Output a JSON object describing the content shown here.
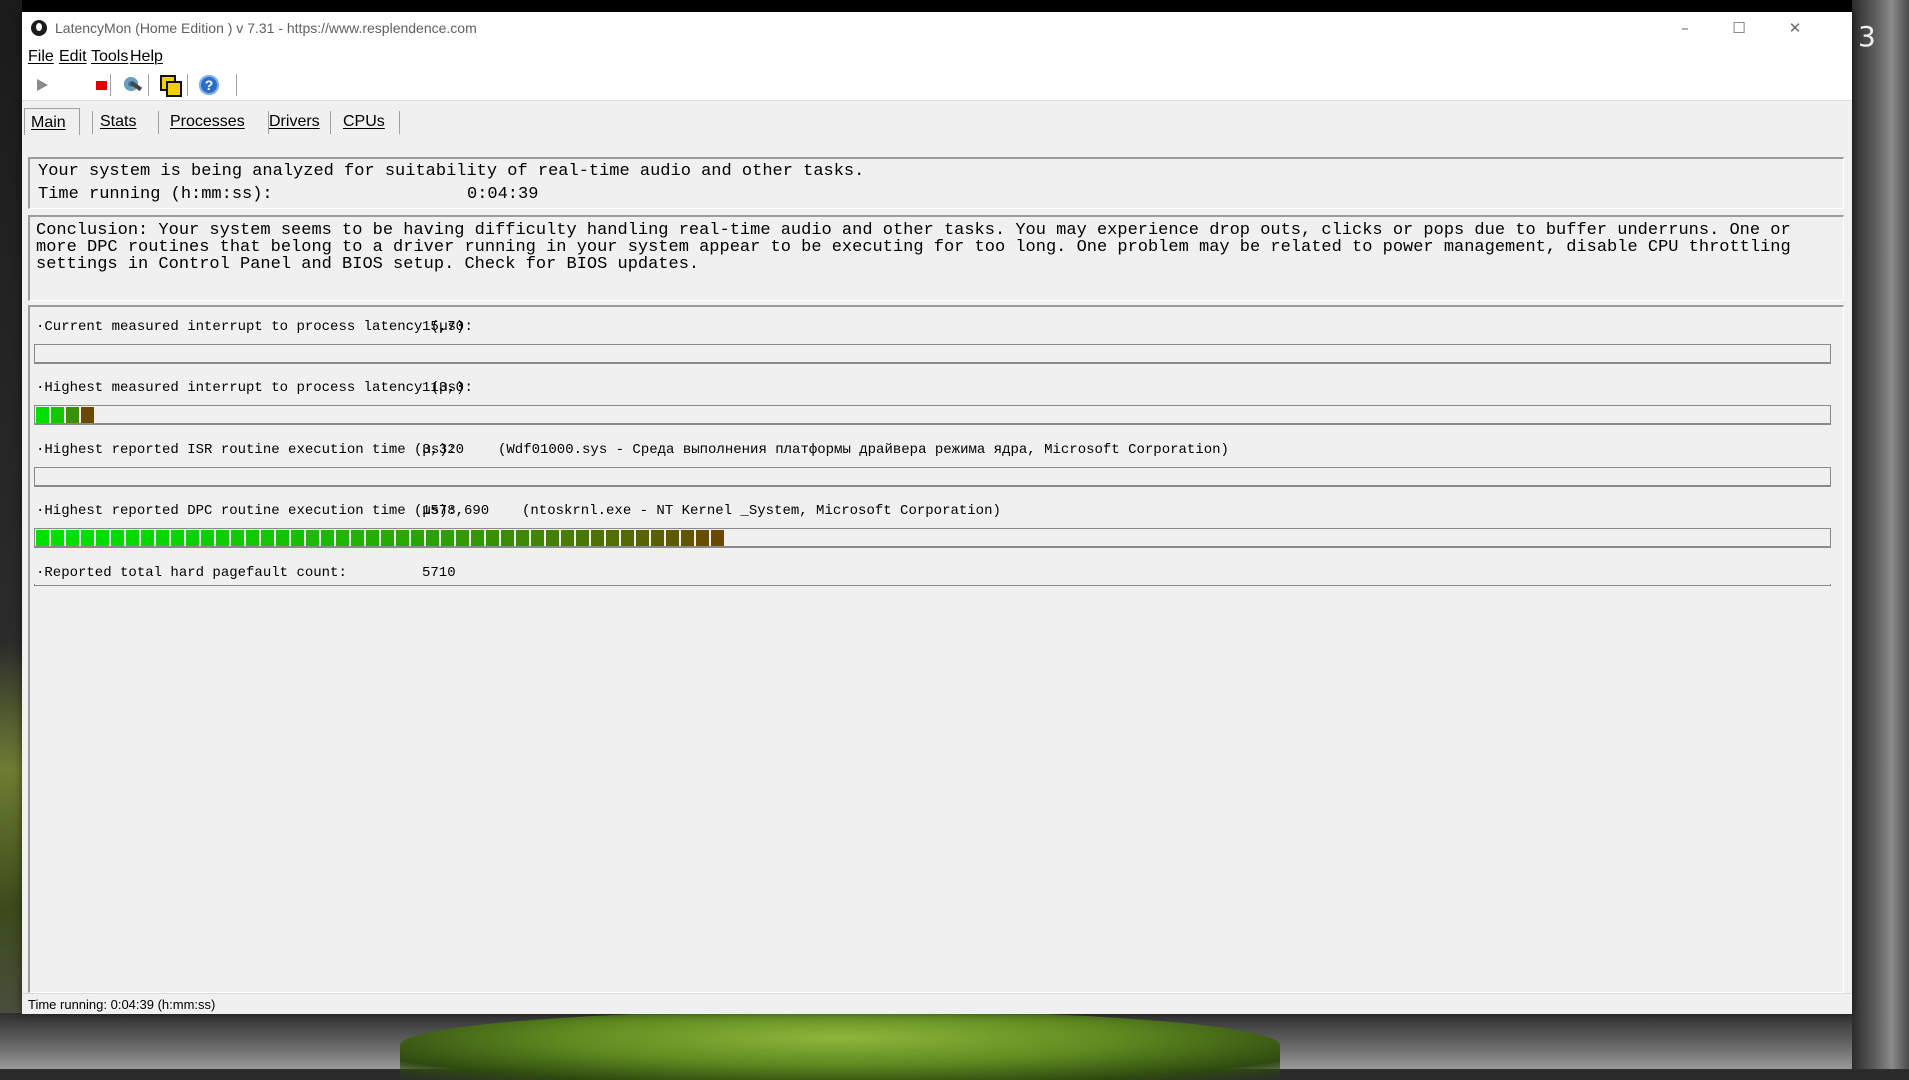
{
  "window": {
    "title": "LatencyMon  (Home Edition )  v 7.31 - https://www.resplendence.com",
    "controls": {
      "minimize": "–",
      "maximize": "☐",
      "close": "✕"
    }
  },
  "menu": {
    "file": "File",
    "edit": "Edit",
    "tools": "Tools",
    "help": "Help"
  },
  "toolbar": {
    "icons": [
      "play-icon",
      "stop-icon",
      "gear-icon",
      "windows-icon",
      "help-icon"
    ],
    "help_glyph": "?"
  },
  "tabs": [
    "Main",
    "Stats",
    "Processes",
    "Drivers",
    "CPUs"
  ],
  "status": {
    "line1": "Your system is being analyzed for suitability of real-time audio and other tasks.",
    "time_label": "Time running (h:mm:ss):",
    "time_value": "0:04:39"
  },
  "conclusion": "Conclusion: Your system seems to be having difficulty handling real-time audio and other tasks. You may experience drop outs, clicks or pops due to buffer underruns. One or more DPC routines that belong to a driver running in your system appear to be executing for too long. One problem may be related to power management, disable CPU throttling settings in Control Panel and BIOS setup. Check for BIOS updates.",
  "metrics": [
    {
      "label": "·Current measured interrupt to process latency (µs):",
      "value": "15,70",
      "detail": "",
      "bar_level": 0,
      "bar_max_segments": 0
    },
    {
      "label": "·Highest measured interrupt to process latency (µs):",
      "value": "113,0",
      "detail": "",
      "bar_level": 0.032,
      "bar_max_segments": 4
    },
    {
      "label": "·Highest reported ISR routine execution time (µs):",
      "value": "3,320",
      "detail": "(Wdf01000.sys - Среда выполнения платформы драйвера режима ядра, Microsoft Corporation)",
      "bar_level": 0,
      "bar_max_segments": 0
    },
    {
      "label": "·Highest reported DPC routine execution time (µs):",
      "value": "1578,690",
      "detail": "(ntoskrnl.exe - NT Kernel _System, Microsoft Corporation)",
      "bar_level": 0.38,
      "bar_max_segments": 46
    },
    {
      "label": "·Reported total hard pagefault count:",
      "value": "5710",
      "detail": "",
      "bar_level": null,
      "bar_max_segments": 0
    }
  ],
  "colors": {
    "bar_start": "#00e000",
    "bar_end": "#6a4a00",
    "window_bg": "#f0f0f0"
  },
  "statusbar": {
    "text": "Time running: 0:04:39  (h:mm:ss)"
  }
}
